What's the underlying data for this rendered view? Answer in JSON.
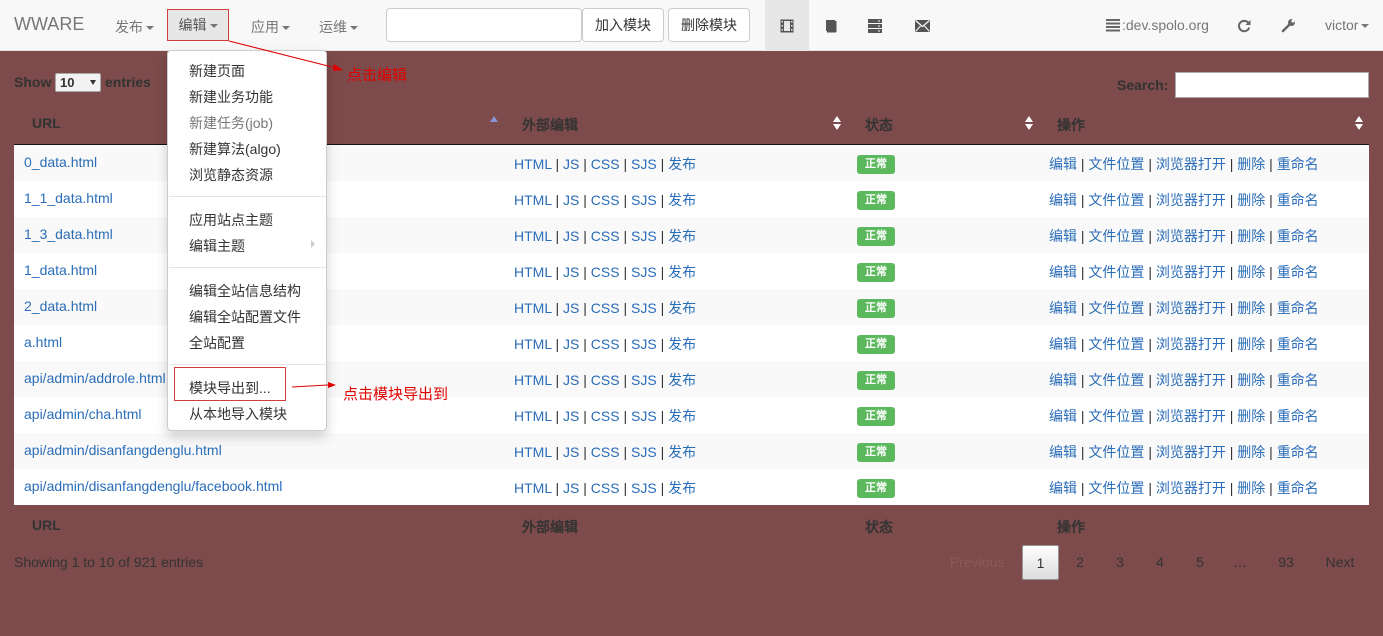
{
  "navbar": {
    "brand": "WWARE",
    "menus": {
      "publish": "发布",
      "edit": "编辑",
      "app": "应用",
      "ops": "运维"
    },
    "search_value": "",
    "add_module_label": "加入模块",
    "delete_module_label": "删除模块",
    "domain": ":dev.spolo.org",
    "user": "victor",
    "icons": [
      "film-icon",
      "book-icon",
      "server-icon",
      "envelope-icon",
      "domain-icon",
      "refresh-icon",
      "wrench-icon"
    ]
  },
  "dropdown": {
    "items": [
      "新建页面",
      "新建业务功能",
      "新建任务(job)",
      "新建算法(algo)",
      "浏览静态资源",
      "应用站点主题",
      "编辑主题",
      "编辑全站信息结构",
      "编辑全站配置文件",
      "全站配置",
      "模块导出到...",
      "从本地导入模块"
    ]
  },
  "annotations": {
    "click_edit": "点击编辑",
    "click_export": "点击模块导出到"
  },
  "table": {
    "show_label": "Show",
    "length_value": "10",
    "entries_label": "entries",
    "search_label": "Search:",
    "search_value": "",
    "columns": [
      "URL",
      "外部编辑",
      "状态",
      "操作"
    ],
    "ext_links": [
      "HTML",
      "JS",
      "CSS",
      "SJS",
      "发布"
    ],
    "op_links": [
      "编辑",
      "文件位置",
      "浏览器打开",
      "删除",
      "重命名"
    ],
    "status": "正常",
    "sep": "|",
    "rows": [
      "0_data.html",
      "1_1_data.html",
      "1_3_data.html",
      "1_data.html",
      "2_data.html",
      "a.html",
      "api/admin/addrole.html",
      "api/admin/cha.html",
      "api/admin/disanfangdenglu.html",
      "api/admin/disanfangdenglu/facebook.html"
    ],
    "info": "Showing 1 to 10 of 921 entries"
  },
  "pagination": {
    "prev": "Previous",
    "pages": [
      "1",
      "2",
      "3",
      "4",
      "5",
      "…",
      "93"
    ],
    "next": "Next",
    "current": "1"
  },
  "colors": {
    "page_bg": "#7d4b4b",
    "link": "#2a6db8",
    "badge": "#5cb85c",
    "annotation": "#e00000"
  }
}
